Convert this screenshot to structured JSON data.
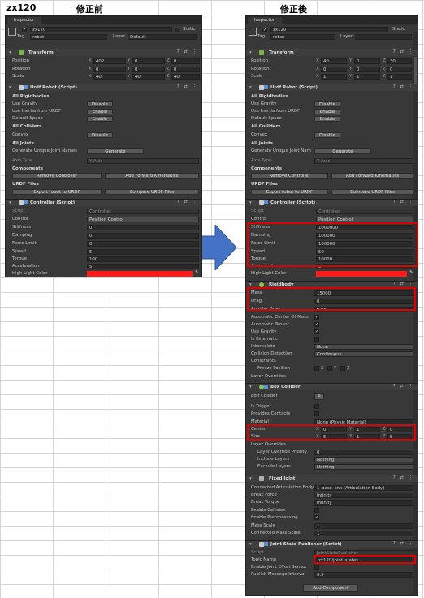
{
  "sheet": {
    "cell_a1": "zx120",
    "before_title": "修正前",
    "after_title": "修正後"
  },
  "common": {
    "tab": "Inspector",
    "object_name": "zx120",
    "static": "Static",
    "tag_label": "Tag",
    "tag_value": "robot",
    "layer_label": "Layer",
    "transform": {
      "title": "Transform",
      "position": "Position",
      "rotation": "Rotation",
      "scale": "Scale",
      "x": "X",
      "y": "Y",
      "z": "Z"
    },
    "urdf": {
      "title": "Urdf Robot (Script)",
      "all_rigidbodies": "All Rigidbodies",
      "use_gravity": "Use Gravity",
      "use_inertia": "Use Inertia from URDF",
      "default_space": "Default Space",
      "all_colliders": "All Colliders",
      "convex": "Convex",
      "all_joints": "All Joints",
      "gen_unique_before": "Generate Unique Joint Names",
      "gen_unique_after": "Generate Unique Joint Nam",
      "generate": "Generate",
      "axis_type": "Axis Type",
      "y_axis": "Y Axis",
      "components": "Components",
      "remove_controller": "Remove Controller",
      "add_forward_kinematics": "Add Forward Kinematics",
      "urdf_files": "URDF Files",
      "export": "Export robot to URDF",
      "compare": "Compare URDF Files",
      "disable": "Disable",
      "enable": "Enable"
    },
    "controller": {
      "title": "Controller (Script)",
      "script": "Script",
      "script_value": "Controller",
      "control": "Control",
      "control_value": "Position Control",
      "stiffness": "Stiffness",
      "damping": "Damping",
      "force_limit": "Force Limit",
      "speed": "Speed",
      "torque": "Torque",
      "acceleration": "Acceleration",
      "highlight": "High Light Color"
    }
  },
  "before": {
    "layer_value": "Default",
    "position": [
      "402",
      "0",
      "0"
    ],
    "rotation": [
      "0",
      "0",
      "0"
    ],
    "scale": [
      "40",
      "40",
      "40"
    ],
    "stiffness": "0",
    "damping": "0",
    "force_limit": "0",
    "speed": "5",
    "torque": "100",
    "acceleration": "5"
  },
  "after": {
    "layer_value": "",
    "position": [
      "40",
      "0",
      "30"
    ],
    "rotation": [
      "0",
      "0",
      "0"
    ],
    "scale": [
      "1",
      "1",
      "1"
    ],
    "stiffness": "1000000",
    "damping": "100000",
    "force_limit": "100000",
    "speed": "50",
    "torque": "10000",
    "acceleration": "5",
    "rigidbody": {
      "title": "Rigidbody",
      "mass": "Mass",
      "mass_value": "15000",
      "drag": "Drag",
      "drag_value": "0",
      "angular_drag": "Angular Drag",
      "angular_drag_value": "0.05",
      "auto_center": "Automatic Center Of Mass",
      "auto_tensor": "Automatic Tensor",
      "use_gravity": "Use Gravity",
      "is_kinematic": "Is Kinematic",
      "interpolate": "Interpolate",
      "interpolate_value": "None",
      "collision_detection": "Collision Detection",
      "collision_value": "Continuous",
      "constraints": "Constraints",
      "freeze_position": "Freeze Position",
      "layer_overrides": "Layer Overrides"
    },
    "box_collider": {
      "title": "Box Collider",
      "edit_collider": "Edit Collider",
      "is_trigger": "Is Trigger",
      "provides_contacts": "Provides Contacts",
      "material": "Material",
      "material_value": "None (Physic Material)",
      "center": "Center",
      "center_values": [
        "0",
        "1",
        "0"
      ],
      "size": "Size",
      "size_values": [
        "5",
        "1",
        "5"
      ],
      "layer_overrides": "Layer Overrides",
      "layer_override_priority": "Layer Override Priority",
      "priority_value": "0",
      "include_layers": "Include Layers",
      "include_value": "Nothing",
      "exclude_layers": "Exclude Layers",
      "exclude_value": "Nothing"
    },
    "fixed_joint": {
      "title": "Fixed Joint",
      "connected_body": "Connected Articulation Body",
      "connected_value": "1_base_link (Articulation Body)",
      "break_force": "Break Force",
      "break_force_value": "Infinity",
      "break_torque": "Break Torque",
      "break_torque_value": "Infinity",
      "enable_collision": "Enable Collision",
      "enable_preprocessing": "Enable Preprocessing",
      "mass_scale": "Mass Scale",
      "mass_scale_value": "1",
      "connected_mass_scale": "Connected Mass Scale",
      "connected_mass_scale_value": "1"
    },
    "publisher": {
      "title": "Joint State Publisher (Script)",
      "script": "Script",
      "script_value": "JointStatePublisher",
      "topic_name": "Topic Name",
      "topic_value": "zx120/joint_states",
      "enable_joint_effort": "Enable Joint Effort Sensor",
      "publish_interval": "Publish Message Interval",
      "interval_value": "0.5"
    },
    "add_component": "Add Component"
  },
  "colors": {
    "highlight": "#ff1a1a",
    "annotation": "#e00000",
    "arrow": "#4472c4",
    "panel_bg": "#383838"
  },
  "icons": [
    "gameobject-cube-icon",
    "transform-icon",
    "script-icon",
    "rigidbody-icon",
    "box-collider-icon",
    "fixed-joint-icon",
    "arrow-right-icon",
    "eyedropper-icon",
    "edit-collider-icon"
  ]
}
